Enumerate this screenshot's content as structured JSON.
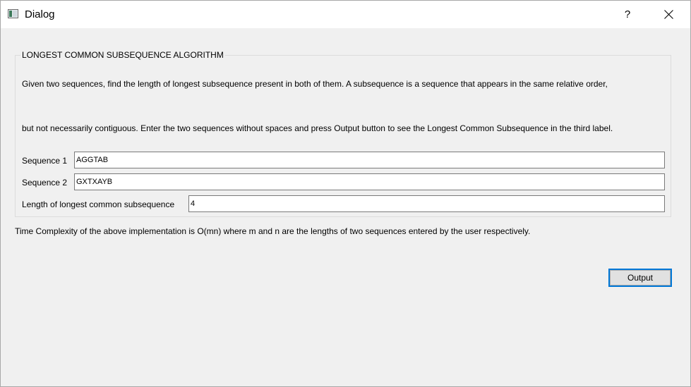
{
  "window": {
    "title": "Dialog",
    "help_label": "?",
    "icon": "app-window-icon",
    "close_icon": "close-icon"
  },
  "group": {
    "title": "LONGEST COMMON SUBSEQUENCE ALGORITHM",
    "description_line1": "Given two sequences, find the length of longest subsequence present in both of them. A subsequence is a sequence that appears in the same relative order,",
    "description_line2": "but not necessarily contiguous. Enter the two sequences without spaces and press Output button to see the Longest Common Subsequence in the third label."
  },
  "fields": {
    "sequence1_label": "Sequence 1",
    "sequence1_value": "AGGTAB",
    "sequence2_label": "Sequence 2",
    "sequence2_value": "GXTXAYB",
    "result_label": "Length of longest common subsequence",
    "result_value": "4"
  },
  "complexity_note": "Time Complexity of the above implementation is O(mn) where m and n are the lengths of two sequences entered by the user respectively.",
  "actions": {
    "output_label": "Output"
  },
  "colors": {
    "focus_border": "#0078d7",
    "background": "#f0f0f0"
  }
}
